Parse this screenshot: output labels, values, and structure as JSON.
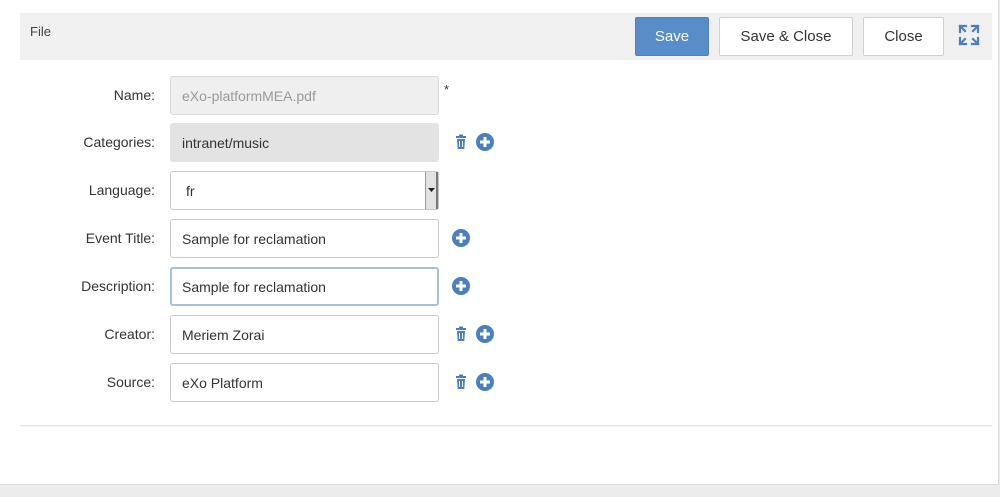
{
  "toolbar": {
    "title": "File",
    "save_label": "Save",
    "save_close_label": "Save & Close",
    "close_label": "Close",
    "maximize_icon": "expand-icon"
  },
  "form": {
    "required_marker": "*",
    "fields": {
      "name": {
        "label": "Name:",
        "value": "eXo-platformMEA.pdf"
      },
      "categories": {
        "label": "Categories:",
        "value": "intranet/music"
      },
      "language": {
        "label": "Language:",
        "value": "fr"
      },
      "event_title": {
        "label": "Event Title:",
        "value": "Sample for reclamation"
      },
      "description": {
        "label": "Description:",
        "value": "Sample for reclamation"
      },
      "creator": {
        "label": "Creator:",
        "value": "Meriem Zorai"
      },
      "source": {
        "label": "Source:",
        "value": "eXo Platform"
      }
    }
  },
  "colors": {
    "primary": "#578dc9",
    "icon_blue": "#4a7fc1",
    "toolbar_bg": "#f0f0f0"
  }
}
